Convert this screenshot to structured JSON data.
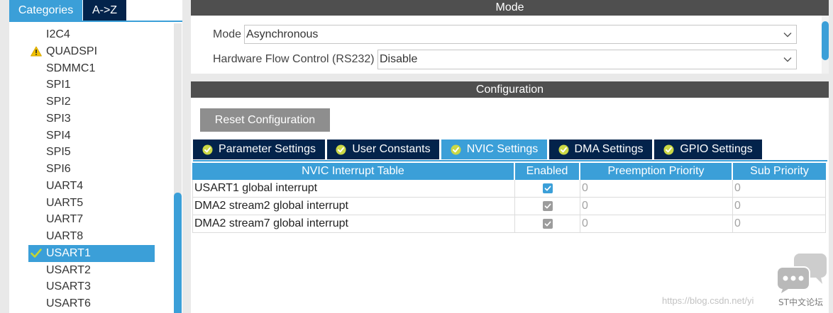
{
  "colors": {
    "accent_blue": "#3b9fd8",
    "navy_tab": "#03234b",
    "section_header": "#4f4f4f",
    "button_gray": "#8e8e8e",
    "status_ok": "#c5d532",
    "status_warning": "#f2c200"
  },
  "left_panel": {
    "tabs": [
      {
        "label": "Categories",
        "selected": true
      },
      {
        "label": "A->Z",
        "selected": false
      }
    ],
    "items": [
      {
        "label": "I2C4"
      },
      {
        "label": "QUADSPI",
        "icon": "warning-icon"
      },
      {
        "label": "SDMMC1"
      },
      {
        "label": "SPI1"
      },
      {
        "label": "SPI2"
      },
      {
        "label": "SPI3"
      },
      {
        "label": "SPI4"
      },
      {
        "label": "SPI5"
      },
      {
        "label": "SPI6"
      },
      {
        "label": "UART4"
      },
      {
        "label": "UART5"
      },
      {
        "label": "UART7"
      },
      {
        "label": "UART8"
      },
      {
        "label": "USART1",
        "icon": "check-icon",
        "selected": true
      },
      {
        "label": "USART2"
      },
      {
        "label": "USART3"
      },
      {
        "label": "USART6"
      }
    ]
  },
  "mode": {
    "title": "Mode",
    "mode_label": "Mode",
    "mode_value": "Asynchronous",
    "flow_label": "Hardware Flow Control (RS232)",
    "flow_value": "Disable"
  },
  "configuration": {
    "title": "Configuration",
    "reset_label": "Reset Configuration",
    "tabs": [
      {
        "label": "Parameter Settings",
        "icon": "check-circle-icon",
        "selected": false
      },
      {
        "label": "User Constants",
        "icon": "check-circle-icon",
        "selected": false
      },
      {
        "label": "NVIC Settings",
        "icon": "check-circle-icon",
        "selected": true
      },
      {
        "label": "DMA Settings",
        "icon": "check-circle-icon",
        "selected": false
      },
      {
        "label": "GPIO Settings",
        "icon": "check-circle-icon",
        "selected": false
      }
    ],
    "nvic_table": {
      "headers": [
        "NVIC Interrupt Table",
        "Enabled",
        "Preemption Priority",
        "Sub Priority"
      ],
      "rows": [
        {
          "interrupt": "USART1 global interrupt",
          "enabled": true,
          "locked": false,
          "preemption_priority": "0",
          "sub_priority": "0"
        },
        {
          "interrupt": "DMA2 stream2 global interrupt",
          "enabled": true,
          "locked": true,
          "preemption_priority": "0",
          "sub_priority": "0"
        },
        {
          "interrupt": "DMA2 stream7 global interrupt",
          "enabled": true,
          "locked": true,
          "preemption_priority": "0",
          "sub_priority": "0"
        }
      ]
    }
  },
  "watermark": {
    "url": "https://blog.csdn.net/yi",
    "forum": "ST中文论坛"
  }
}
